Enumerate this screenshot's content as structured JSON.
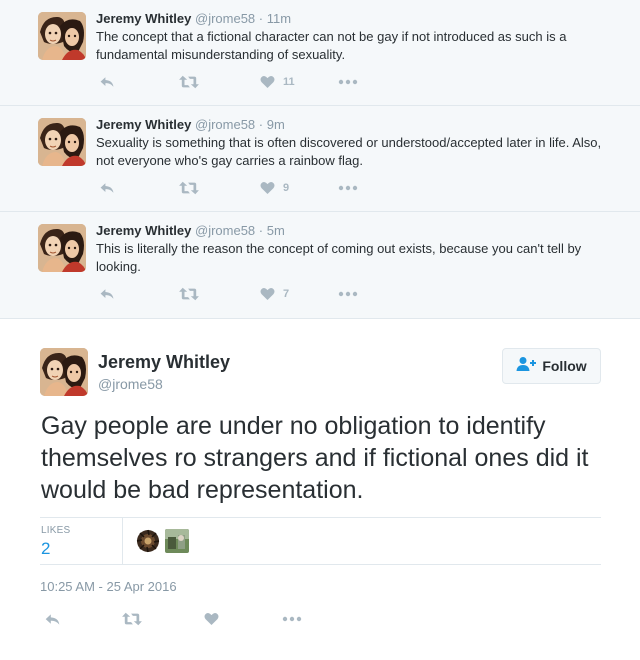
{
  "replies": [
    {
      "name": "Jeremy Whitley",
      "handle": "@jrome58",
      "sep": "·",
      "time": "11m",
      "text": "The concept that a fictional character can not be gay if not introduced as such is a fundamental misunderstanding of sexuality.",
      "likes": "11"
    },
    {
      "name": "Jeremy Whitley",
      "handle": "@jrome58",
      "sep": "·",
      "time": "9m",
      "text": "Sexuality is something that is often discovered or understood/accepted later in life. Also, not everyone who's gay carries a rainbow flag.",
      "likes": "9"
    },
    {
      "name": "Jeremy Whitley",
      "handle": "@jrome58",
      "sep": "·",
      "time": "5m",
      "text": "This is literally the reason the concept of coming out exists, because you can't tell by looking.",
      "likes": "7"
    }
  ],
  "main": {
    "name": "Jeremy Whitley",
    "handle": "@jrome58",
    "follow_label": "Follow",
    "text": "Gay people are under no obligation to identify themselves ro strangers and if fictional ones did it would be bad representation.",
    "likes_label": "LIKES",
    "likes_count": "2",
    "timestamp": "10:25 AM - 25 Apr 2016"
  },
  "icons": {
    "reply": "reply-icon",
    "retweet": "retweet-icon",
    "like": "heart-icon",
    "more": "more-icon",
    "follow": "add-user-icon"
  },
  "colors": {
    "accent": "#1b95e0",
    "muted": "#8899a6",
    "icon": "#aab8c2",
    "thread_bg": "#f5f8fa"
  }
}
